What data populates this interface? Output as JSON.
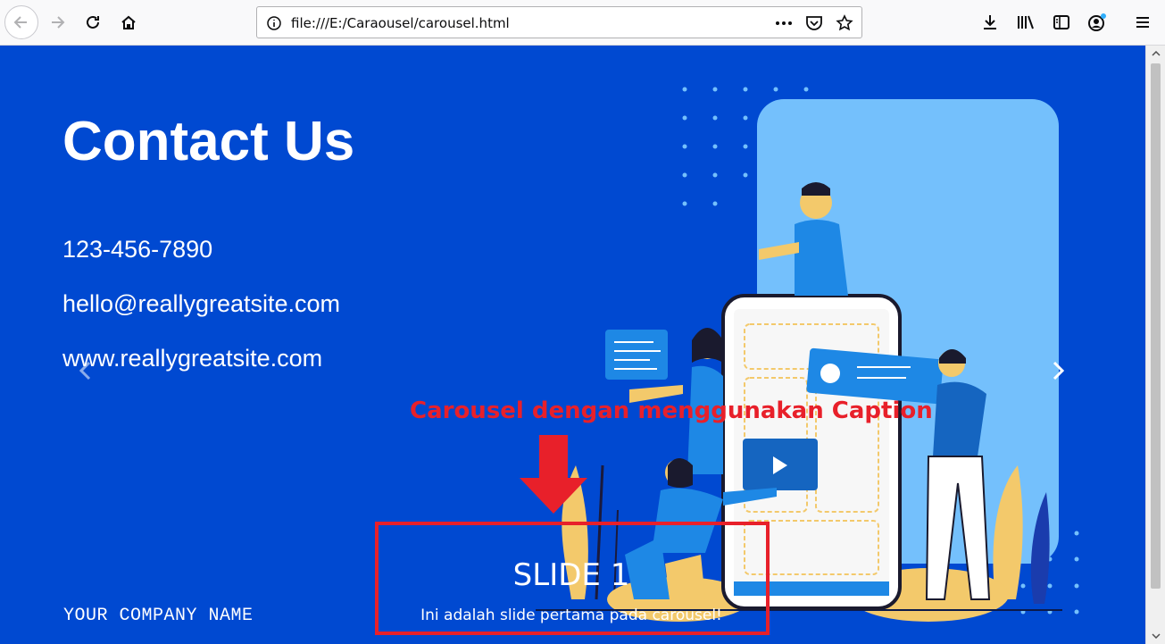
{
  "browser": {
    "url": "file:///E:/Caraousel/carousel.html",
    "icons": [
      "back-icon",
      "forward-icon",
      "reload-icon",
      "home-icon",
      "info-icon",
      "more-icon",
      "pocket-icon",
      "star-icon",
      "download-icon",
      "library-icon",
      "sidebar-icon",
      "account-icon",
      "menu-icon"
    ]
  },
  "page": {
    "title": "Contact Us",
    "phone": "123-456-7890",
    "email": "hello@reallygreatsite.com",
    "website": "www.reallygreatsite.com",
    "company": "YOUR COMPANY NAME"
  },
  "carousel": {
    "slide_title": "SLIDE 1",
    "slide_caption": "Ini adalah slide pertama pada carousel!",
    "prev_icon": "chevron-left-icon",
    "next_icon": "chevron-right-icon"
  },
  "annotation": {
    "label": "Carousel dengan menggunakan Caption"
  },
  "colors": {
    "page_bg": "#0049d1",
    "annotation": "#e8202a",
    "illustration_light": "#74c0fc",
    "illustration_yellow": "#f3c96b"
  }
}
